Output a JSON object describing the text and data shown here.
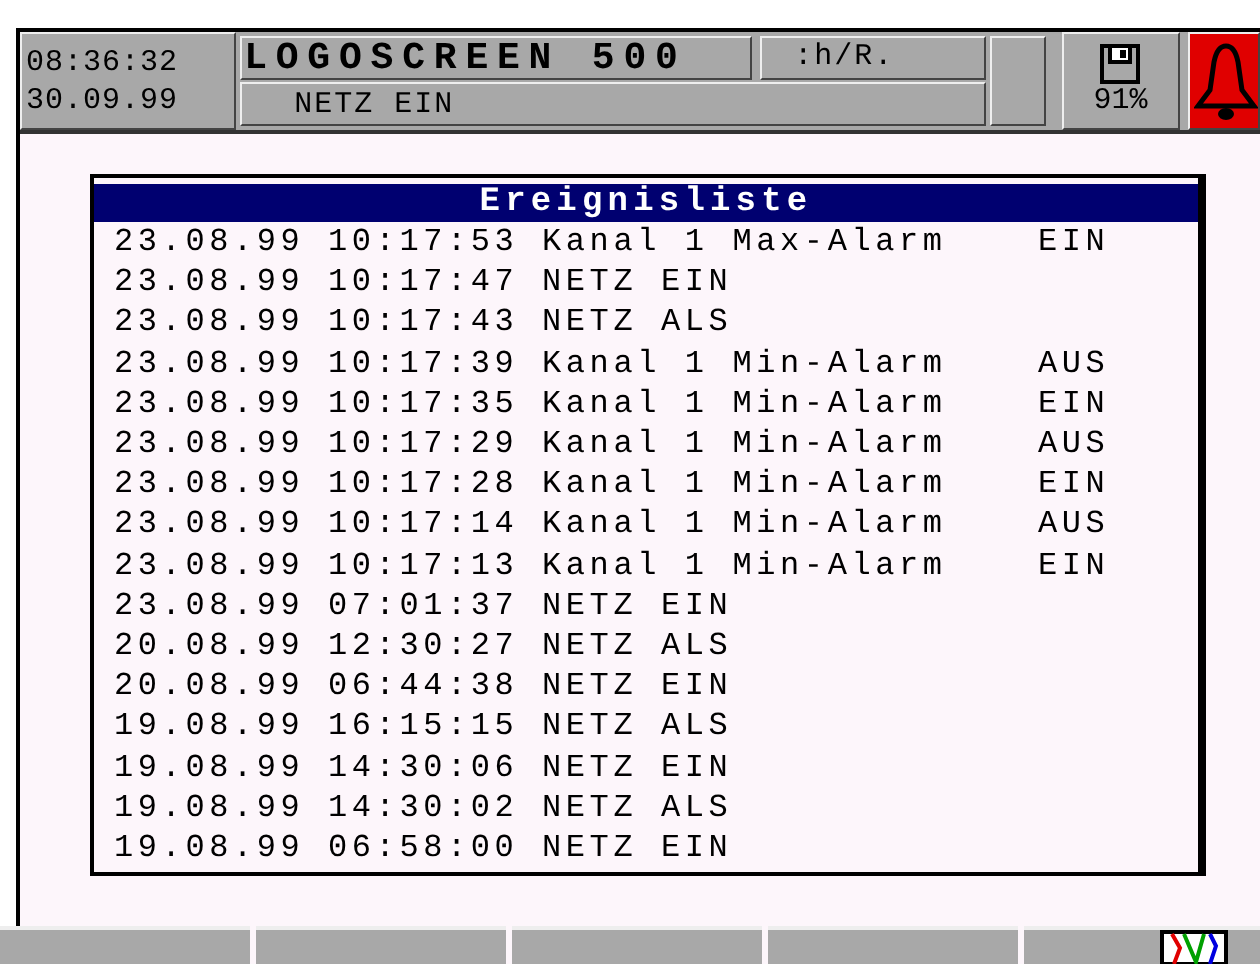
{
  "header": {
    "time": "08:36:32",
    "date": "30.09.99",
    "title": "LOGOSCREEN 500",
    "mode": ":h/R.",
    "message": "NETZ EIN",
    "memory": "91%",
    "alarm_active": true
  },
  "event_list": {
    "title": "Ereignisliste",
    "rows": [
      {
        "date": "23.08.99",
        "time": "10:17:53",
        "event": "Kanal 1 Max-Alarm",
        "status": "EIN"
      },
      {
        "date": "23.08.99",
        "time": "10:17:47",
        "event": "NETZ EIN"
      },
      {
        "date": "23.08.99",
        "time": "10:17:43",
        "event": "NETZ ALS"
      },
      {
        "date": "23.08.99",
        "time": "10:17:39",
        "event": "Kanal 1 Min-Alarm",
        "status": "AUS"
      },
      {
        "date": "23.08.99",
        "time": "10:17:35",
        "event": "Kanal 1 Min-Alarm",
        "status": "EIN"
      },
      {
        "date": "23.08.99",
        "time": "10:17:29",
        "event": "Kanal 1 Min-Alarm",
        "status": "AUS"
      },
      {
        "date": "23.08.99",
        "time": "10:17:28",
        "event": "Kanal 1 Min-Alarm",
        "status": "EIN"
      },
      {
        "date": "23.08.99",
        "time": "10:17:14",
        "event": "Kanal 1 Min-Alarm",
        "status": "AUS"
      },
      {
        "date": "23.08.99",
        "time": "10:17:13",
        "event": "Kanal 1 Min-Alarm",
        "status": "EIN"
      },
      {
        "date": "23.08.99",
        "time": "07:01:37",
        "event": "NETZ EIN"
      },
      {
        "date": "20.08.99",
        "time": "12:30:27",
        "event": "NETZ ALS"
      },
      {
        "date": "20.08.99",
        "time": "06:44:38",
        "event": "NETZ EIN"
      },
      {
        "date": "19.08.99",
        "time": "16:15:15",
        "event": "NETZ ALS"
      },
      {
        "date": "19.08.99",
        "time": "14:30:06",
        "event": "NETZ EIN"
      },
      {
        "date": "19.08.99",
        "time": "14:30:02",
        "event": "NETZ ALS"
      },
      {
        "date": "19.08.99",
        "time": "06:58:00",
        "event": "NETZ EIN"
      }
    ]
  },
  "softkeys": [
    {
      "kind": "blank"
    },
    {
      "kind": "blank"
    },
    {
      "kind": "blank"
    },
    {
      "kind": "blank"
    },
    {
      "kind": "chart"
    }
  ]
}
